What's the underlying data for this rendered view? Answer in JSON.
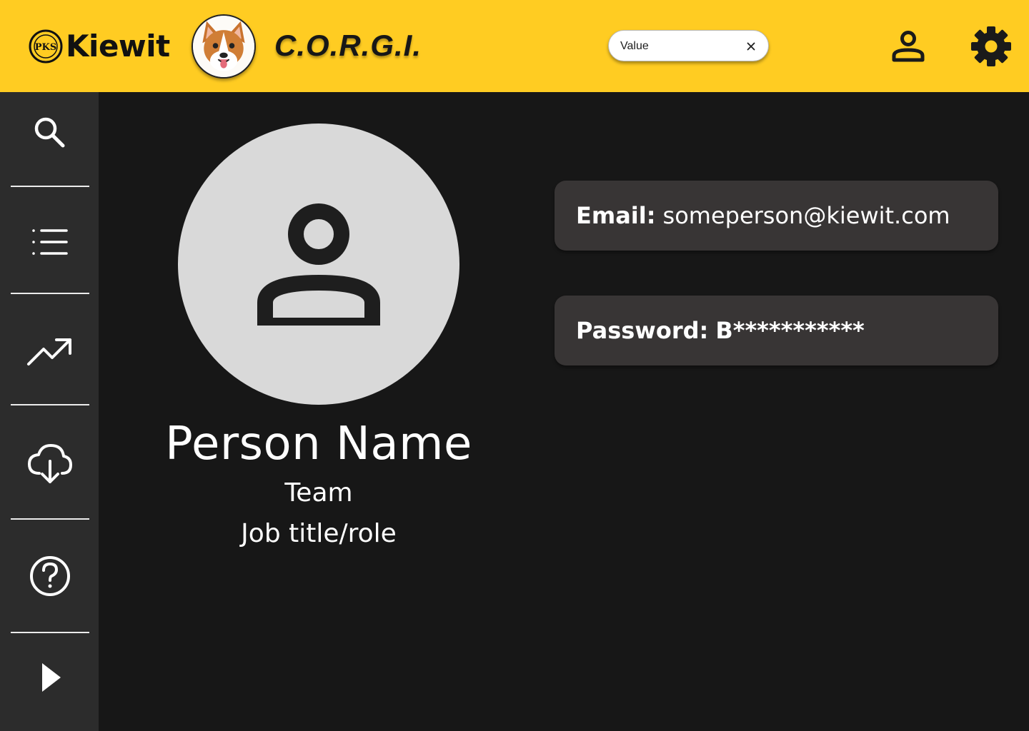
{
  "header": {
    "brand": "Kiewit",
    "seal_text": "PKS",
    "app_title": "C.O.R.G.I.",
    "search": {
      "value": "Value"
    },
    "accent_color": "#FFCC22"
  },
  "sidebar": {
    "items": [
      {
        "icon": "search-icon"
      },
      {
        "icon": "list-icon"
      },
      {
        "icon": "trending-up-icon"
      },
      {
        "icon": "cloud-download-icon"
      },
      {
        "icon": "help-circle-icon"
      },
      {
        "icon": "play-arrow-icon"
      }
    ]
  },
  "profile": {
    "name": "Person Name",
    "team": "Team",
    "role": "Job title/role",
    "email_label": "Email:",
    "email": "someperson@kiewit.com",
    "password_label": "Password:",
    "password": "B***********"
  }
}
